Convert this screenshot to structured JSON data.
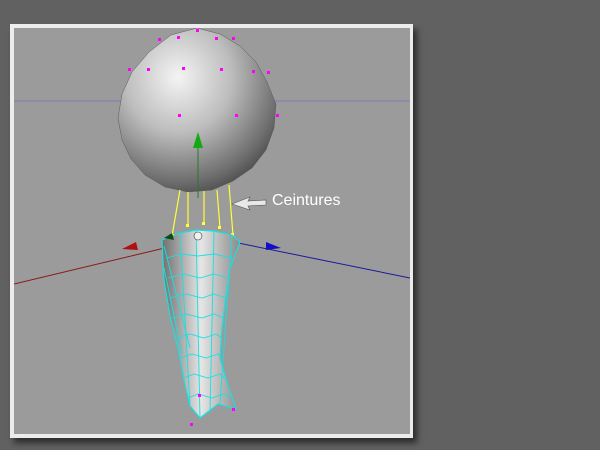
{
  "viewport": {
    "name": "3d-perspective-viewport",
    "background_color": "#9b9b9b"
  },
  "annotation": {
    "callout_label": "Ceintures",
    "arrow_color": "#e8e8e8"
  },
  "scene": {
    "objects": [
      {
        "name": "sphere",
        "color": "#bdbdbd",
        "vertex_color": "#ff00ff"
      },
      {
        "name": "deformed-mesh",
        "wire_color": "#19e0e0",
        "vertex_color": "#ff00ff"
      },
      {
        "name": "ceinture-links",
        "color": "#ffff33"
      }
    ],
    "axes": [
      {
        "name": "x-axis",
        "color": "#aa1111"
      },
      {
        "name": "y-axis",
        "color": "#11aa11"
      },
      {
        "name": "z-axis",
        "color": "#1111cc"
      }
    ]
  }
}
